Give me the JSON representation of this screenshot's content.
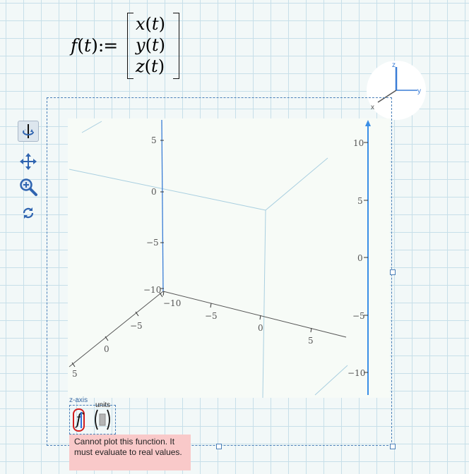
{
  "formula": {
    "name": "f",
    "arg": "t",
    "assign": ":=",
    "components": [
      "x",
      "y",
      "z"
    ]
  },
  "gizmo": {
    "axes": [
      "z",
      "y",
      "x"
    ]
  },
  "toolbar": {
    "tools": [
      "rotate-icon",
      "pan-icon",
      "zoom-icon",
      "reset-icon"
    ],
    "active": "rotate-icon"
  },
  "plot": {
    "z_tick_labels": [
      "5",
      "0",
      "−5",
      "−10"
    ],
    "x_tick_labels": [
      "5",
      "0",
      "−5",
      "−10"
    ],
    "y_tick_labels": [
      "−10",
      "−5",
      "0",
      "5"
    ],
    "colorbar_tick_labels": [
      "10",
      "5",
      "0",
      "−5",
      "−10"
    ],
    "colors": {
      "axis_z": "#3a7dd6",
      "box_edges": "#a9cfe0",
      "axis_xy": "#555555",
      "colorbar": "#3a8ee6"
    }
  },
  "placeholders": {
    "zaxis_label": "z-axis",
    "units_label": "units",
    "function_glyph": "f"
  },
  "error": {
    "message": "Cannot plot this function. It must evaluate to real values."
  }
}
